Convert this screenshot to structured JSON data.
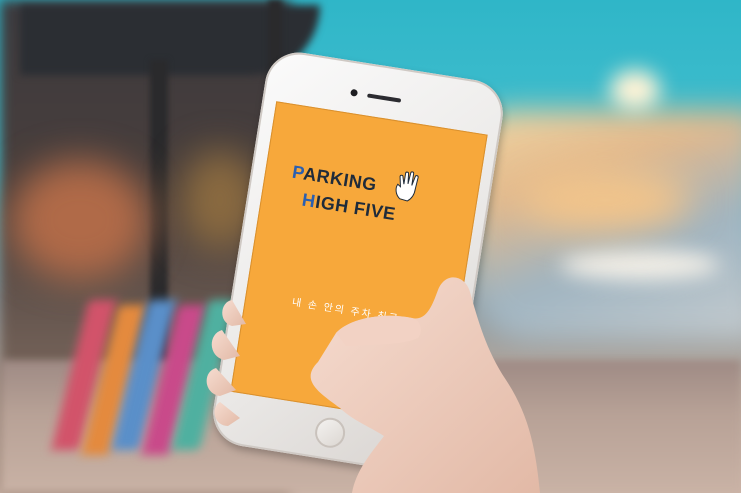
{
  "app": {
    "name_line1_first": "P",
    "name_line1_rest": "ARKING",
    "name_line2_first": "H",
    "name_line2_rest": "IGH FIVE",
    "tagline": "내 손 안의 주차 친구",
    "logo_icon": "hand-wave-icon"
  },
  "colors": {
    "screen_background": "#f7a83b",
    "title_text": "#1f2b3a",
    "title_accent": "#2a5fb0",
    "tagline_text": "#ffffff"
  }
}
